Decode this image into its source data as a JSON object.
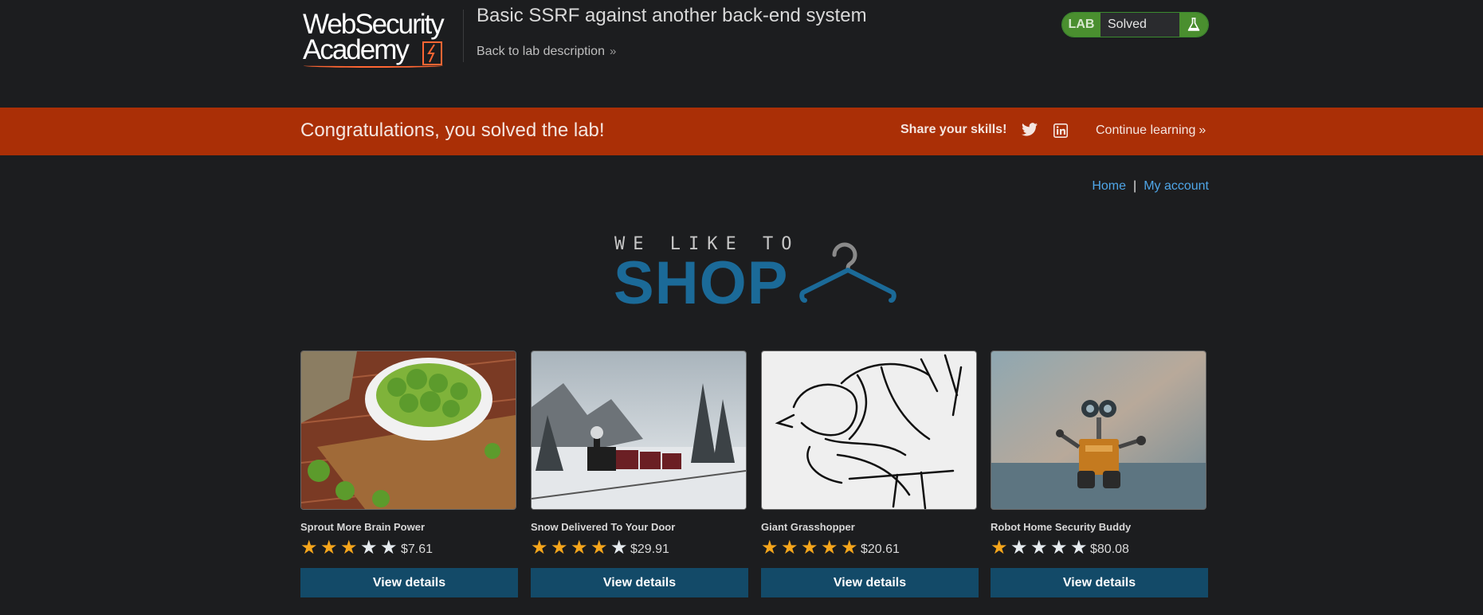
{
  "header": {
    "logo_line1": "WebSecurity",
    "logo_line2": "Academy",
    "lab_title": "Basic SSRF against another back-end system",
    "back_link": "Back to lab description",
    "back_chevron": "»",
    "badge": {
      "lab": "LAB",
      "status": "Solved",
      "icon": "flask-icon"
    }
  },
  "banner": {
    "message": "Congratulations, you solved the lab!",
    "share": "Share your skills!",
    "continue": "Continue learning",
    "continue_chevron": "»",
    "icons": [
      "twitter-icon",
      "linkedin-icon"
    ]
  },
  "nav": {
    "home": "Home",
    "separator": "|",
    "account": "My account"
  },
  "shop_logo": {
    "tagline": "WE LIKE TO",
    "word": "SHOP",
    "icon": "hanger-icon"
  },
  "products": [
    {
      "name": "Sprout More Brain Power",
      "rating": 3,
      "max": 5,
      "price": "$7.61",
      "button": "View details"
    },
    {
      "name": "Snow Delivered To Your Door",
      "rating": 4,
      "max": 5,
      "price": "$29.91",
      "button": "View details"
    },
    {
      "name": "Giant Grasshopper",
      "rating": 5,
      "max": 5,
      "price": "$20.61",
      "button": "View details"
    },
    {
      "name": "Robot Home Security Buddy",
      "rating": 1,
      "max": 5,
      "price": "$80.08",
      "button": "View details"
    }
  ],
  "colors": {
    "background": "#1c1d1f",
    "banner": "#aa2f06",
    "accent_blue": "#1b6a98",
    "button": "#134a68",
    "link": "#4fa6e8",
    "lab_green": "#4a8f2f",
    "star": "#f6a61c"
  }
}
